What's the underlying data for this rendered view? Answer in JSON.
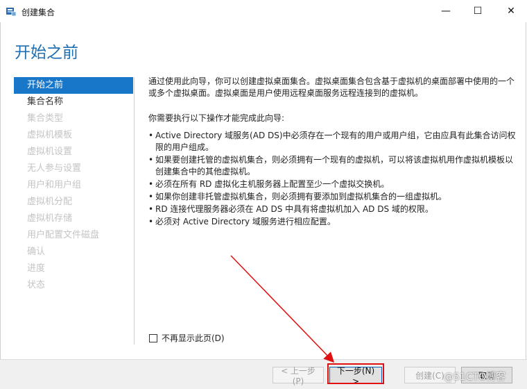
{
  "window": {
    "title": "创建集合",
    "minimize_symbol": "—",
    "maximize_symbol": "☐",
    "close_symbol": "✕"
  },
  "page": {
    "title": "开始之前"
  },
  "sidebar": {
    "items": [
      {
        "label": "开始之前",
        "state": "active"
      },
      {
        "label": "集合名称",
        "state": "enabled"
      },
      {
        "label": "集合类型",
        "state": "disabled"
      },
      {
        "label": "虚拟机模板",
        "state": "disabled"
      },
      {
        "label": "虚拟机设置",
        "state": "disabled"
      },
      {
        "label": "无人参与设置",
        "state": "disabled"
      },
      {
        "label": "用户和用户组",
        "state": "disabled"
      },
      {
        "label": "虚拟机分配",
        "state": "disabled"
      },
      {
        "label": "虚拟机存储",
        "state": "disabled"
      },
      {
        "label": "用户配置文件磁盘",
        "state": "disabled"
      },
      {
        "label": "确认",
        "state": "disabled"
      },
      {
        "label": "进度",
        "state": "disabled"
      },
      {
        "label": "状态",
        "state": "disabled"
      }
    ]
  },
  "content": {
    "intro": "通过使用此向导，你可以创建虚拟桌面集合。虚拟桌面集合包含基于虚拟机的桌面部署中使用的一个或多个虚拟桌面。虚拟桌面是用户使用远程桌面服务远程连接到的虚拟机。",
    "prereq_heading": "你需要执行以下操作才能完成此向导:",
    "bullet_symbol": "•",
    "bullets": [
      "Active Directory 域服务(AD DS)中必须存在一个现有的用户或用户组，它由应具有此集合访问权限的用户组成。",
      "如果要创建托管的虚拟机集合，则必须拥有一个现有的虚拟机，可以将该虚拟机用作虚拟机模板以创建集合中的其他虚拟机。",
      "必须在所有 RD 虚拟化主机服务器上配置至少一个虚拟交换机。",
      "如果你创建非托管虚拟机集合，则必须拥有要添加到虚拟机集合的一组虚拟机。",
      "RD 连接代理服务器必须在 AD DS 中具有将虚拟机加入 AD DS 域的权限。",
      "必须对 Active Directory 域服务进行相应配置。"
    ]
  },
  "checkbox": {
    "label": "不再显示此页(D)",
    "checked": false
  },
  "footer": {
    "prev_label": "< 上一步(P)",
    "next_label": "下一步(N) >",
    "create_label": "创建(C)",
    "cancel_label": "取消"
  },
  "watermark": {
    "text": "@51CTO博客"
  },
  "colors": {
    "title_blue": "#1f6fb2",
    "nav_active_bg": "#1877c9",
    "annotation_red": "#e01010"
  }
}
